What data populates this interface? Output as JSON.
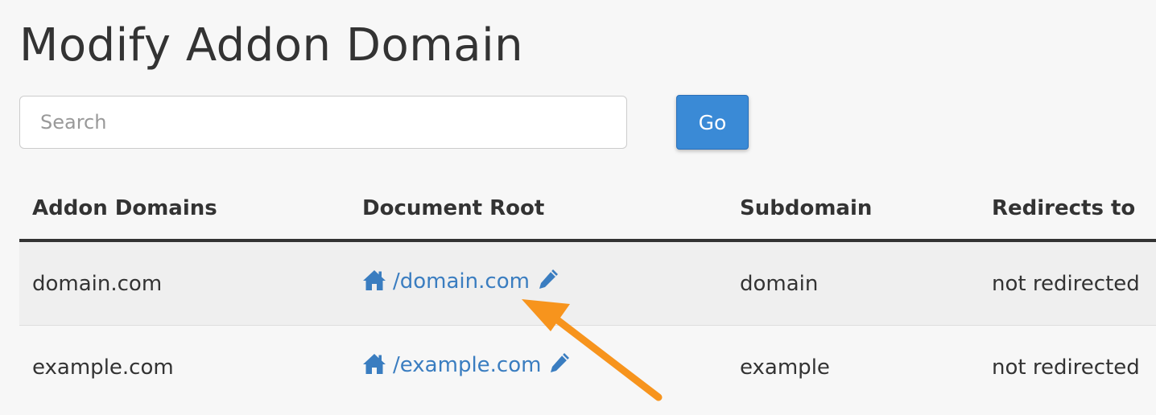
{
  "page": {
    "title": "Modify Addon Domain"
  },
  "search": {
    "placeholder": "Search",
    "value": "",
    "button_label": "Go"
  },
  "table": {
    "headers": [
      "Addon Domains",
      "Document Root",
      "Subdomain",
      "Redirects to"
    ],
    "rows": [
      {
        "domain": "domain.com",
        "document_root": "/domain.com",
        "subdomain": "domain",
        "redirects_to": "not redirected"
      },
      {
        "domain": "example.com",
        "document_root": "/example.com",
        "subdomain": "example",
        "redirects_to": "not redirected"
      }
    ]
  },
  "icons": {
    "home": "home-icon",
    "edit": "pencil-icon"
  },
  "colors": {
    "link": "#3a7dc0",
    "button": "#3a8ad6",
    "annotation_arrow": "#f7941d"
  }
}
